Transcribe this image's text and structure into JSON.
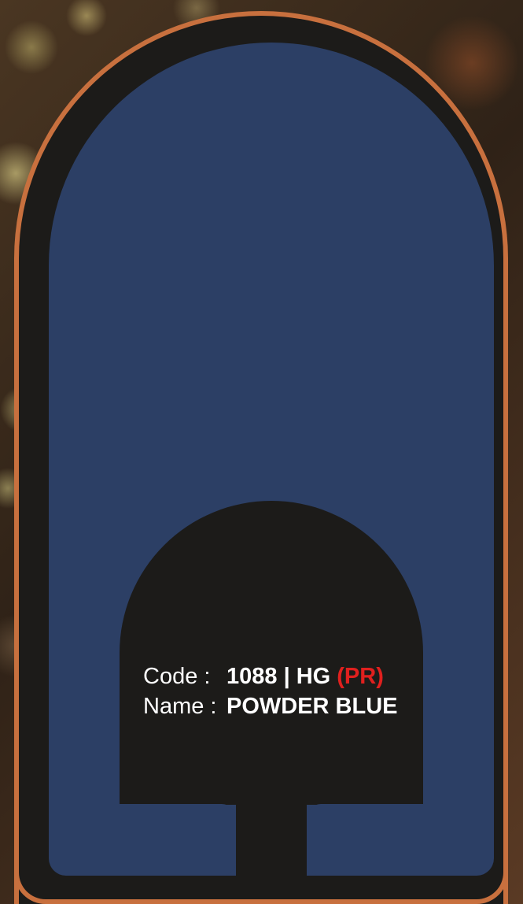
{
  "swatch": {
    "color": "#2c3f65",
    "code_label": "Code :",
    "code_value": "1088 | HG",
    "code_suffix": "(PR)",
    "name_label": "Name :",
    "name_value": "POWDER BLUE"
  },
  "colors": {
    "frame_border": "#c8703e",
    "frame_fill": "#1c1b19",
    "text": "#ffffff",
    "accent": "#e0201e"
  }
}
